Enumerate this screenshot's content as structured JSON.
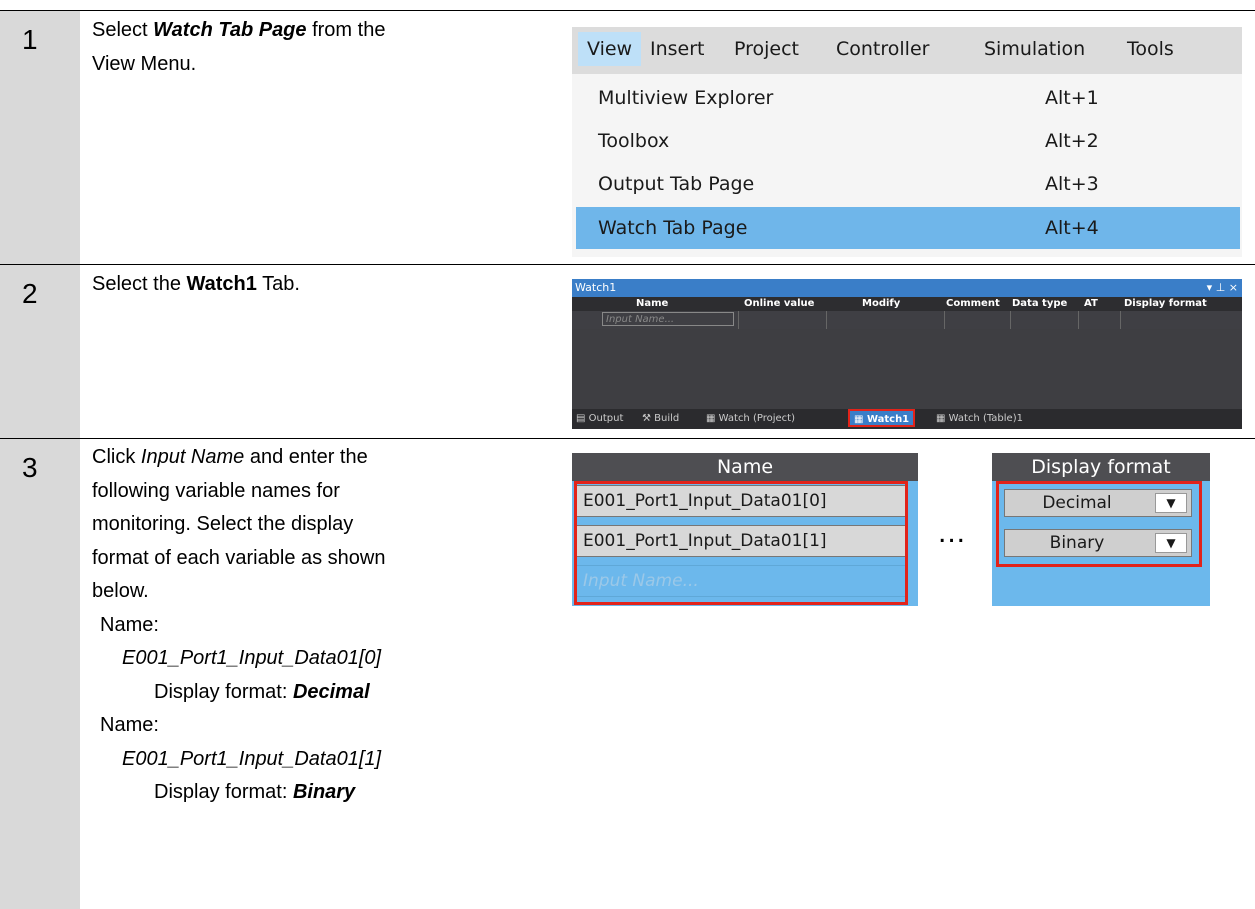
{
  "steps": [
    {
      "num": "1"
    },
    {
      "num": "2"
    },
    {
      "num": "3"
    }
  ],
  "step1": {
    "pre": "Select ",
    "em": "Watch Tab Page",
    "post": " from the",
    "line2": "View Menu."
  },
  "step2": {
    "pre": "Select the ",
    "em": "Watch1",
    "post": " Tab."
  },
  "step3": {
    "l1_pre": "Click ",
    "l1_em": "Input Name",
    "l1_post": " and enter the",
    "l2": "following variable names for",
    "l3": "monitoring. Select the display",
    "l4": "format of each variable as shown",
    "l5": "below.",
    "name_label": "Name:",
    "var1": "E001_Port1_Input_Data01[0]",
    "fmt_label": "Display format: ",
    "fmt1": "Decimal",
    "var2": "E001_Port1_Input_Data01[1]",
    "fmt2": "Binary"
  },
  "menu": {
    "bar": [
      "View",
      "Insert",
      "Project",
      "Controller",
      "Simulation",
      "Tools"
    ],
    "items": [
      {
        "label": "Multiview Explorer",
        "shortcut": "Alt+1"
      },
      {
        "label": "Toolbox",
        "shortcut": "Alt+2"
      },
      {
        "label": "Output Tab Page",
        "shortcut": "Alt+3"
      },
      {
        "label": "Watch Tab Page",
        "shortcut": "Alt+4"
      }
    ]
  },
  "watch": {
    "title": "Watch1",
    "controls": "▾ ⊥ ×",
    "columns": [
      "Name",
      "Online value",
      "Modify",
      "Comment",
      "Data type",
      "AT",
      "Display format"
    ],
    "input_placeholder": "Input Name...",
    "tabs": [
      "Output",
      "Build",
      "Watch (Project)",
      "Watch1",
      "Watch (Table)1"
    ]
  },
  "zoom": {
    "name_header": "Name",
    "rows": [
      "E001_Port1_Input_Data01[0]",
      "E001_Port1_Input_Data01[1]"
    ],
    "placeholder": "Input Name...",
    "dots": "...",
    "fmt_header": "Display format",
    "fmts": [
      "Decimal",
      "Binary"
    ],
    "arrow": "▼"
  },
  "colors": {
    "step_column": "#d9d9d9",
    "menu_selected": "#6fb6ea",
    "watch_title": "#3a7ec8",
    "highlight_box": "#e2231a"
  }
}
